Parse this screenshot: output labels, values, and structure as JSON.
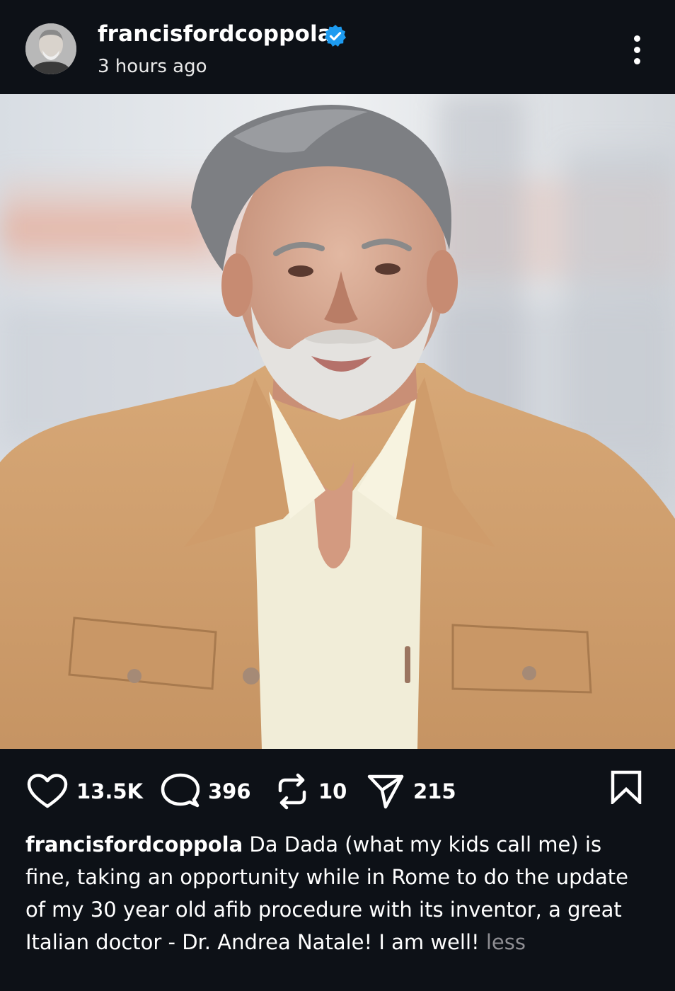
{
  "post": {
    "username": "francisfordcoppola",
    "timestamp": "3 hours ago",
    "verified": true,
    "accent_color": "#1d9bf0"
  },
  "actions": {
    "likes": "13.5K",
    "comments": "396",
    "reposts": "10",
    "shares": "215",
    "icons": [
      "heart-icon",
      "comment-icon",
      "repost-icon",
      "share-icon",
      "bookmark-icon"
    ]
  },
  "caption": {
    "username": "francisfordcoppola",
    "text": "Da Dada (what my kids call me) is fine, taking an opportunity while in Rome to do the update of my 30 year old afib procedure with its inventor, a great Italian doctor - Dr. Andrea Natale! I am well!",
    "less_label": "less"
  }
}
